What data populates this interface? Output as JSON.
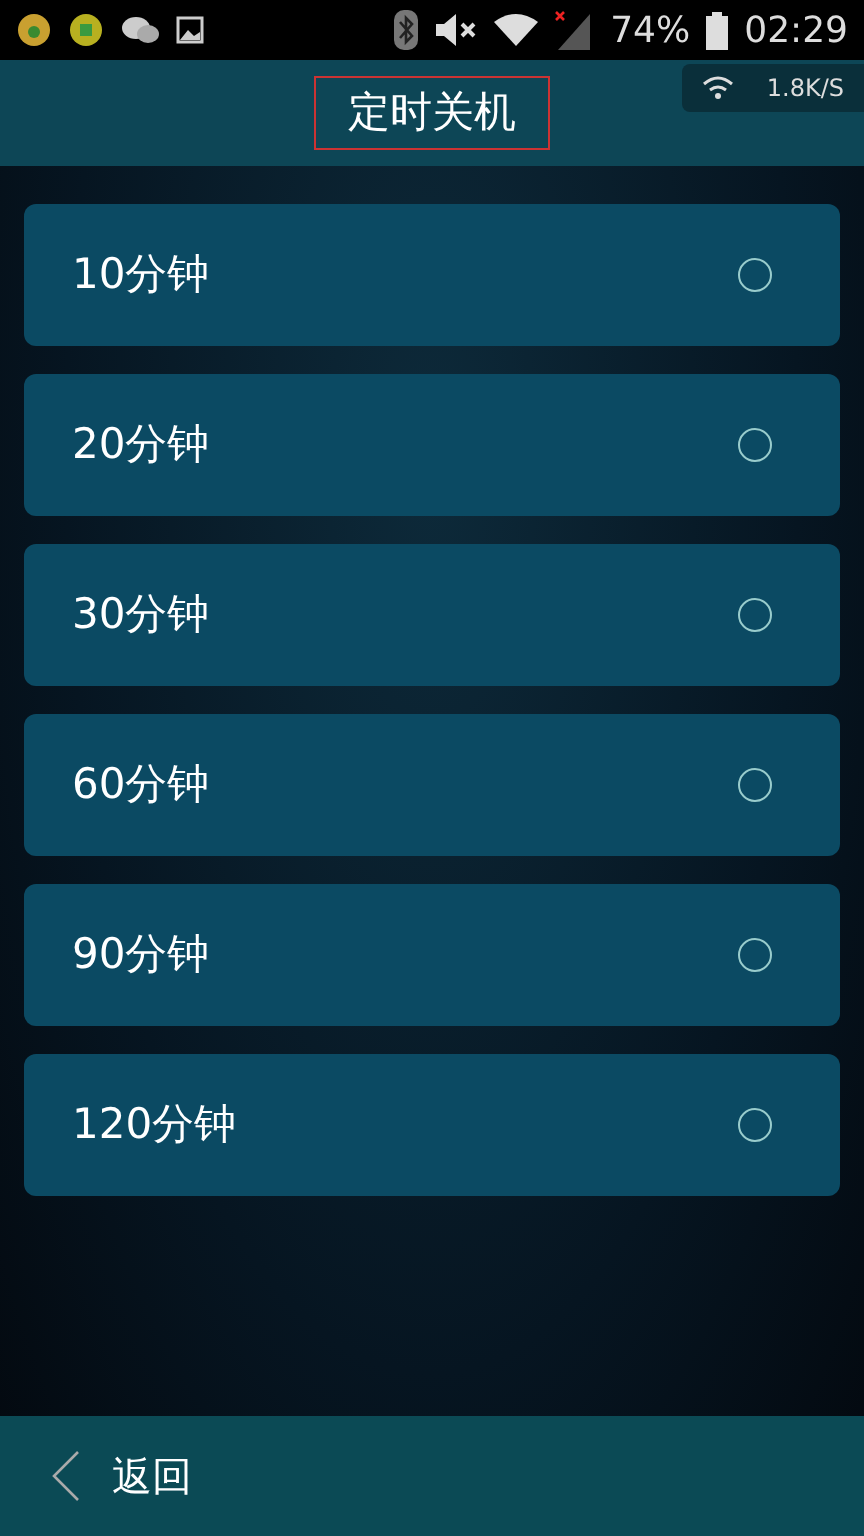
{
  "status_bar": {
    "battery": "74%",
    "time": "02:29",
    "net_speed": "1.8K/S"
  },
  "header": {
    "title": "定时关机"
  },
  "options": [
    {
      "label": "10分钟",
      "selected": false
    },
    {
      "label": "20分钟",
      "selected": false
    },
    {
      "label": "30分钟",
      "selected": false
    },
    {
      "label": "60分钟",
      "selected": false
    },
    {
      "label": "90分钟",
      "selected": false
    },
    {
      "label": "120分钟",
      "selected": false
    }
  ],
  "footer": {
    "back": "返回"
  }
}
